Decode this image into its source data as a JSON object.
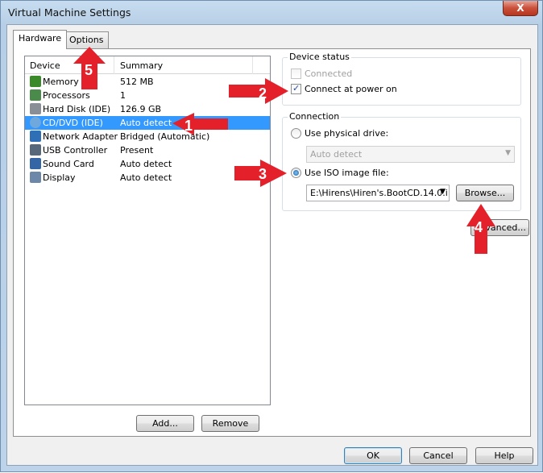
{
  "window": {
    "title": "Virtual Machine Settings",
    "close_label": "X"
  },
  "tabs": [
    {
      "label": "Hardware",
      "active": true
    },
    {
      "label": "Options",
      "active": false
    }
  ],
  "device_list": {
    "headers": {
      "device": "Device",
      "summary": "Summary"
    },
    "rows": [
      {
        "device": "Memory",
        "summary": "512 MB",
        "icon": "memory-icon",
        "selected": false
      },
      {
        "device": "Processors",
        "summary": "1",
        "icon": "processor-icon",
        "selected": false
      },
      {
        "device": "Hard Disk (IDE)",
        "summary": "126.9 GB",
        "icon": "hard-disk-icon",
        "selected": false
      },
      {
        "device": "CD/DVD (IDE)",
        "summary": "Auto detect",
        "icon": "cd-dvd-icon",
        "selected": true
      },
      {
        "device": "Network Adapter",
        "summary": "Bridged (Automatic)",
        "icon": "network-adapter-icon",
        "selected": false
      },
      {
        "device": "USB Controller",
        "summary": "Present",
        "icon": "usb-icon",
        "selected": false
      },
      {
        "device": "Sound Card",
        "summary": "Auto detect",
        "icon": "sound-card-icon",
        "selected": false
      },
      {
        "device": "Display",
        "summary": "Auto detect",
        "icon": "display-icon",
        "selected": false
      }
    ],
    "add_label": "Add...",
    "remove_label": "Remove"
  },
  "device_status": {
    "title": "Device status",
    "connected_label": "Connected",
    "connected_checked": false,
    "connect_power_label": "Connect at power on",
    "connect_power_checked": true
  },
  "connection": {
    "title": "Connection",
    "physical_label": "Use physical drive:",
    "physical_value": "Auto detect",
    "iso_label": "Use ISO image file:",
    "iso_value": "E:\\Hirens\\Hiren's.BootCD.14.0.i",
    "browse_label": "Browse...",
    "selected": "iso"
  },
  "advanced_label": "Advanced...",
  "footer": {
    "ok_label": "OK",
    "cancel_label": "Cancel",
    "help_label": "Help"
  },
  "annotations": [
    {
      "number": "1",
      "points_to": "CD/DVD (IDE) row"
    },
    {
      "number": "2",
      "points_to": "Connect at power on"
    },
    {
      "number": "3",
      "points_to": "Use ISO image file"
    },
    {
      "number": "4",
      "points_to": "Browse button"
    },
    {
      "number": "5",
      "points_to": "Options tab"
    }
  ],
  "colors": {
    "selection": "#3399ff",
    "annotation": "#e4202a"
  }
}
